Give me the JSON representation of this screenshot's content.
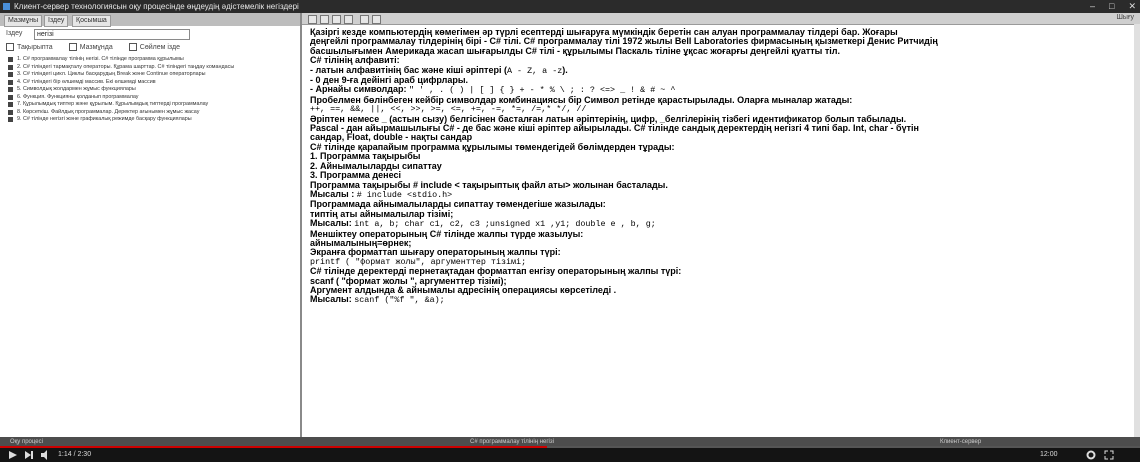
{
  "window": {
    "title": "Клиент-сервер технологиясын оқу процесінде өңдеудің әдістемелік негіздері",
    "controls": [
      "–",
      "□",
      "✕"
    ]
  },
  "left_pane": {
    "tabs": [
      "Мазмұны",
      "Іздеу",
      "Қосымша"
    ],
    "search_label": "Іздеу",
    "search_value": "негізі",
    "options": [
      "Тақырыпта",
      "Мазмұнда",
      "Сөйлем ізде"
    ],
    "toc": [
      "1. C# программалау тілінің негізі. C# тілінде программа құрылымы",
      "2. C# тіліндегі тармақталу операторы. Құрама шарттар. C# тіліндегі таңдау командасы",
      "3. C# тіліндегі цикл. Циклы басқарудың Break және Continue операторлары",
      "4. C# тіліндегі бір өлшемді массив. Екі өлшемді массив",
      "5. Символдық жолдармен жұмыс функциялары",
      "6. Функция. Функцияны қолданып программалау",
      "7. Құрылымдық типтер және құрылым. Құрылымдық типтерді программалау",
      "8. Көрсеткіш. Файлдық программалар. Деректер ағынымен жұмыс жасау",
      "9. C# тілінде негізгі жәнe графикалық режимде басқару функциялары"
    ]
  },
  "right_pane": {
    "toolbar_right": "Шығу",
    "lines": [
      {
        "t": "Қазіргі кезде компьютердің көмегімен әр түрлі есептерді шығаруға мүмкіндік беретін сан алуан программалау тілдері бар. Жоғары"
      },
      {
        "t": "деңгейлі программалау тілдерінің бірі - C# тілі. C# программалау тілі 1972 жылы Bell Laboratories фирмасының қызметкері Денис Ритчидің"
      },
      {
        "t": "басшылығымен Америкада жасап шығарылды C# тілі - құрылымы Паскаль тіліне ұқсас жоғарғы деңгейлі қуатты тіл."
      },
      {
        "t": "C# тілінің алфавиті:"
      },
      {
        "t": "- латын алфавитінің бас және кіші әріптері (",
        "c": "A - Z, a -z",
        "t2": ")."
      },
      {
        "t": "- 0 ден 9-ға дейінгі араб цифрлары."
      },
      {
        "t": "- Арнайы символдар: ",
        "c": "\" ' , . ( ) | [ ] { } + - * % \\ ; : ? <=> _ ! & # ~ ^"
      },
      {
        "t": "Пробелмен бөлінбеген кейбір символдар комбинациясы бір Символ ретінде қарастырылады. Оларға мыналар жатады:"
      },
      {
        "code": "++, ==, &&, ||, <<, >>, >=, <=, +=, -=, *=, /=,* */, //"
      },
      {
        "t": "Әріптен немесе _ (астын сызу) белгісінен басталған латын әріптерінің, цифр, _белгілерінің тізбегі идентификатор болып табылады."
      },
      {
        "t": "Pascal - дан айырмашылығы C# - де бас және кіші әріптер айырылады. C# тілінде сандық деректердің негізгі 4 типі бар. Int, char - бүтін"
      },
      {
        "t": "сандар, Float, double - нақты сандар"
      },
      {
        "t": "C# тілінде қарапайым программа құрылымы төмендегідей бөлімдерден тұрады:"
      },
      {
        "t": "1. Программа тақырыбы"
      },
      {
        "t": "2. Айнымалыларды сипаттау"
      },
      {
        "t": "3. Программа денесі"
      },
      {
        "t": "Программа тақырыбы # include < тақырыптық файл аты> жолынан басталады."
      },
      {
        "t": "Мысалы : ",
        "c": "# include <stdio.h>"
      },
      {
        "t": "Программада айнымалыларды сипаттау төмендегіше жазылады:"
      },
      {
        "t": "типтің аты айнымалылар тізімі;"
      },
      {
        "t": "Мысалы: ",
        "c": "int a, b; char c1, c2, c3 ;unsigned x1 ,y1; double e , b, g;"
      },
      {
        "t": "Меншіктеу операторының C# тілінде жалпы түрде жазылуы:"
      },
      {
        "t": "айнымалының=өрнек;"
      },
      {
        "t": "Экранға форматтап шығару операторының жалпы түрі:"
      },
      {
        "code": "printf ( \"формат жолы\", аргументтер тізімі;"
      },
      {
        "t": "C# тілінде деректерді пернетақтадан форматтап енгізу операторының жалпы түрі:"
      },
      {
        "t": "scanf ( \"формат жолы \", аргументтер тізімі);"
      },
      {
        "t": "Аргумент алдында & айнымалы адресінің операциясы көрсетіледі ."
      },
      {
        "t": "Мысалы: ",
        "c": "scanf (\"%f \", &a);"
      }
    ]
  },
  "status_bar": {
    "left": "Оқу процесі",
    "center": "C# программалау тілінің негізі",
    "right": "Клиент-сервер"
  },
  "taskbar": {
    "time": "1:14 / 2:30",
    "right": "12:00"
  },
  "video_progress": 0.48
}
